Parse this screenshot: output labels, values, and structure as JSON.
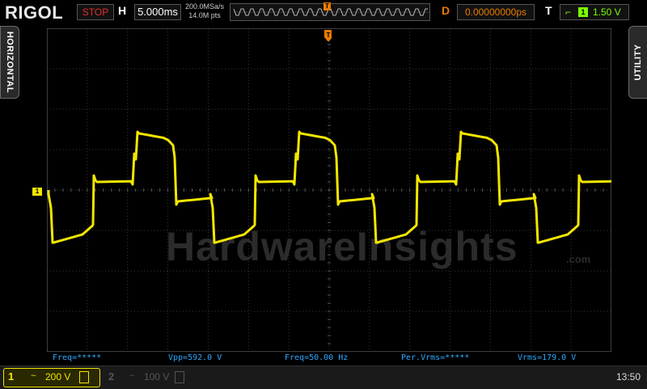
{
  "header": {
    "logo": "RIGOL",
    "run_state": "STOP",
    "horizontal_label": "H",
    "timebase": "5.000ms",
    "sample_rate": "200.0MSa/s",
    "memory_depth": "14.0M pts",
    "trigger_marker": "T",
    "delay_label": "D",
    "delay_value": "0.00000000ps",
    "trigger_label": "T",
    "trigger_source": "1",
    "trigger_level": "1.50 V"
  },
  "side_tabs": {
    "left": "HORIZONTAL",
    "right": "UTILITY"
  },
  "watermark": {
    "text": "HardwareInsights",
    "suffix": ".com"
  },
  "channel_marker": "1",
  "measurements": [
    {
      "label": "Freq=*****"
    },
    {
      "label": "Vpp=592.0 V"
    },
    {
      "label": "Freq=50.00 Hz"
    },
    {
      "label": "Per.Vrms=*****"
    },
    {
      "label": "Vrms=179.0 V"
    }
  ],
  "channels": [
    {
      "number": "1",
      "coupling": "~",
      "scale": "200 V",
      "active": true,
      "color": "#f2e600"
    },
    {
      "number": "2",
      "coupling": "~",
      "scale": "100 V",
      "active": false,
      "color": "#555555"
    }
  ],
  "clock": "13:50",
  "colors": {
    "trace": "#f2e600",
    "trigger": "#e87b00",
    "measure": "#2ea8ff",
    "stop": "#e23030"
  }
}
